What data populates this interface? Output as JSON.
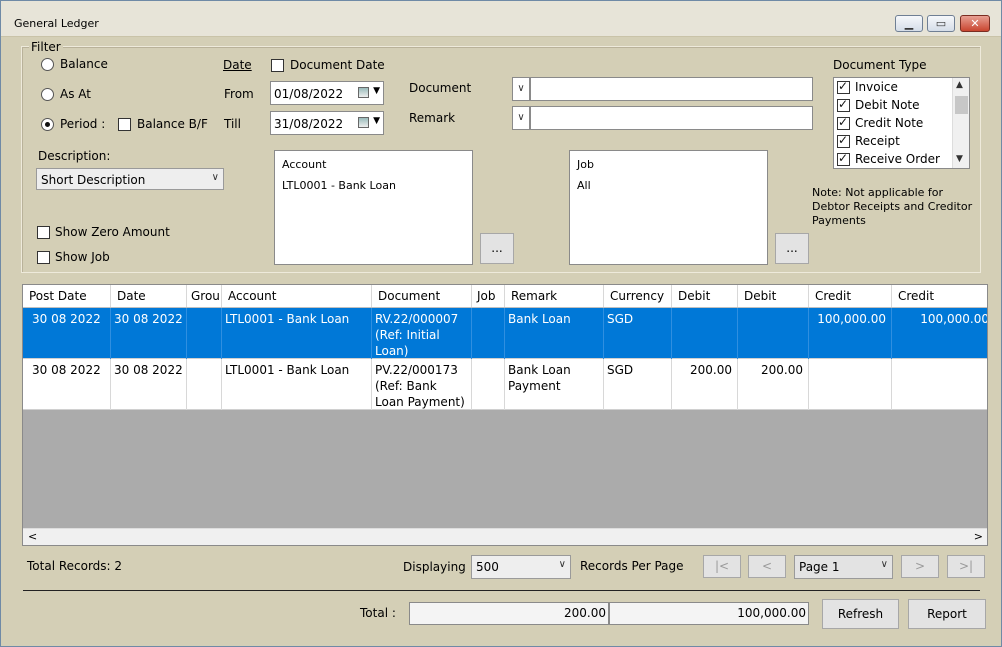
{
  "window": {
    "title": "General Ledger"
  },
  "filter": {
    "legend": "Filter",
    "balance_label": "Balance",
    "as_at_label": "As At",
    "period_label": "Period :",
    "balance_bf_label": "Balance B/F",
    "date_label": "Date",
    "document_date_label": "Document Date",
    "from_label": "From",
    "from_value": "01/08/2022",
    "till_label": "Till",
    "till_value": "31/08/2022",
    "document_label": "Document",
    "document_value": "",
    "remark_label": "Remark",
    "remark_value": "",
    "description_label": "Description:",
    "description_value": "Short Description",
    "show_zero_label": "Show Zero Amount",
    "show_job_label": "Show Job",
    "account_header": "Account",
    "account_value": "LTL0001 - Bank Loan",
    "job_header": "Job",
    "job_value": "All",
    "ellipsis": "...",
    "doctype_label": "Document Type",
    "doctypes": [
      "Invoice",
      "Debit Note",
      "Credit Note",
      "Receipt",
      "Receive Order"
    ],
    "note": "Note: Not applicable for Debtor Receipts and Creditor Payments"
  },
  "grid": {
    "headers": [
      "Post Date",
      "Date",
      "Grou",
      "Account",
      "Document",
      "Job",
      "Remark",
      "Currency",
      "Debit",
      "Debit",
      "Credit",
      "Credit"
    ],
    "rows": [
      {
        "post_date": "30 08 2022",
        "date": "30 08 2022",
        "group": "",
        "account": "LTL0001 - Bank Loan",
        "document": "RV.22/000007 (Ref: Initial Loan)",
        "job": "",
        "remark": "Bank Loan",
        "currency": "SGD",
        "debit1": "",
        "debit2": "",
        "credit1": "100,000.00",
        "credit2": "100,000.00"
      },
      {
        "post_date": "30 08 2022",
        "date": "30 08 2022",
        "group": "",
        "account": "LTL0001 - Bank Loan",
        "document": "PV.22/000173 (Ref: Bank Loan Payment)",
        "job": "",
        "remark": "Bank Loan Payment",
        "currency": "SGD",
        "debit1": "200.00",
        "debit2": "200.00",
        "credit1": "",
        "credit2": ""
      }
    ]
  },
  "footer": {
    "total_records": "Total Records: 2",
    "displaying_label": "Displaying",
    "displaying_value": "500",
    "records_per_page": "Records Per Page",
    "first_label": "|<",
    "prev_label": "<",
    "page_value": "Page 1",
    "next_label": ">",
    "last_label": ">|",
    "total_label": "Total :",
    "total_debit": "200.00",
    "total_credit": "100,000.00",
    "refresh_label": "Refresh",
    "report_label": "Report"
  }
}
